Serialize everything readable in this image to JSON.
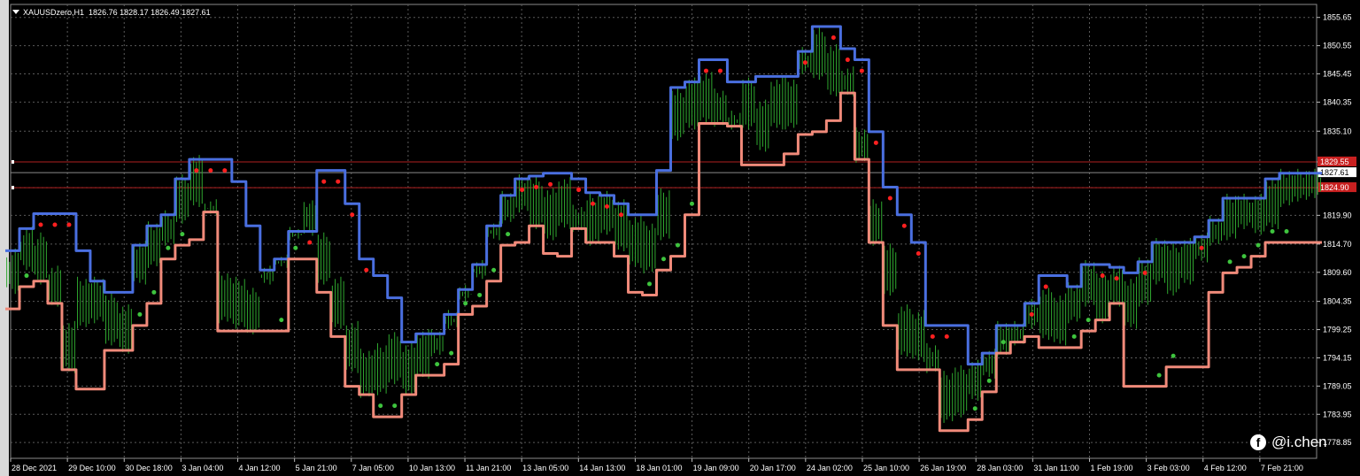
{
  "header": {
    "symbol": "XAUUSDzero,H1",
    "ohlc": "1826.76 1828.17 1826.49 1827.61"
  },
  "watermark": {
    "text": "@i.chen",
    "icon": "facebook-icon"
  },
  "colors": {
    "background": "#000000",
    "grid": "#5a5a5a",
    "upper_band": "#4a6fe0",
    "lower_band": "#f08a7a",
    "candles": "#2fa82f",
    "sell_dots": "#ff2020",
    "buy_dots": "#3ec43e",
    "level_line": "#b02020"
  },
  "chart_data": {
    "type": "line",
    "title": "",
    "xlabel": "",
    "ylabel": "",
    "ylim": [
      1776.0,
      1858.0
    ],
    "y_ticks": [
      "1855.65",
      "1850.55",
      "1845.45",
      "1840.35",
      "1835.10",
      "1829.55",
      "1824.90",
      "1819.90",
      "1814.70",
      "1809.60",
      "1804.35",
      "1799.25",
      "1794.15",
      "1789.05",
      "1783.95",
      "1778.85"
    ],
    "x_ticks": [
      "28 Dec 2021",
      "29 Dec 10:00",
      "30 Dec 18:00",
      "3 Jan 04:00",
      "4 Jan 12:00",
      "5 Jan 21:00",
      "7 Jan 05:00",
      "10 Jan 13:00",
      "11 Jan 21:00",
      "13 Jan 05:00",
      "14 Jan 13:00",
      "18 Jan 01:00",
      "19 Jan 09:00",
      "20 Jan 17:00",
      "24 Jan 02:00",
      "25 Jan 10:00",
      "26 Jan 19:00",
      "28 Jan 03:00",
      "31 Jan 11:00",
      "1 Feb 19:00",
      "3 Feb 03:00",
      "4 Feb 12:00",
      "7 Feb 21:00"
    ],
    "current_price": "1827.61",
    "levels": [
      {
        "label": "1829.55",
        "value": 1829.55
      },
      {
        "label": "1824.90",
        "value": 1824.9
      }
    ],
    "series": [
      {
        "key": "upper",
        "x": [
          0,
          1,
          2,
          3,
          4,
          5,
          6,
          7,
          8,
          9,
          10,
          11,
          12,
          13,
          14,
          15,
          16,
          17,
          18,
          19,
          20,
          21,
          22,
          23,
          24,
          25,
          26,
          27,
          28,
          29,
          30,
          31,
          32,
          33,
          34,
          35,
          36,
          37,
          38,
          39,
          40,
          41,
          42,
          43,
          44,
          45,
          46,
          47,
          48,
          49,
          50,
          51,
          52,
          53,
          54,
          55,
          56,
          57,
          58,
          59,
          60,
          61,
          62,
          63,
          64,
          65,
          66,
          67,
          68,
          69,
          70,
          71,
          72,
          73,
          74,
          75,
          76,
          77,
          78,
          79,
          80,
          81,
          82,
          83,
          84,
          85,
          86,
          87,
          88,
          89,
          90,
          91,
          92
        ],
        "y": [
          1813.5,
          1817.5,
          1820.2,
          1820.2,
          1820.2,
          1813.5,
          1808.0,
          1806.0,
          1806.0,
          1814.5,
          1818.0,
          1820.0,
          1826.5,
          1830.0,
          1830.0,
          1830.0,
          1826.0,
          1818.0,
          1810.0,
          1812.0,
          1817.0,
          1817.0,
          1828.0,
          1828.0,
          1822.0,
          1812.0,
          1809.0,
          1805.0,
          1797.0,
          1798.5,
          1798.5,
          1802.0,
          1806.5,
          1811.0,
          1818.0,
          1823.5,
          1826.5,
          1827.0,
          1827.5,
          1827.5,
          1826.5,
          1824.0,
          1823.5,
          1822.0,
          1820.0,
          1820.0,
          1828.0,
          1843.0,
          1844.0,
          1848.0,
          1848.0,
          1844.0,
          1844.0,
          1845.0,
          1845.0,
          1845.0,
          1849.5,
          1854.0,
          1854.0,
          1850.0,
          1848.0,
          1835.0,
          1825.0,
          1820.0,
          1815.0,
          1800.0,
          1800.0,
          1800.0,
          1793.0,
          1795.0,
          1800.0,
          1800.0,
          1804.0,
          1809.0,
          1809.0,
          1807.0,
          1811.0,
          1811.0,
          1810.5,
          1809.5,
          1811.5,
          1815.0,
          1815.0,
          1815.0,
          1816.0,
          1819.0,
          1823.0,
          1823.0,
          1823.0,
          1826.5,
          1827.5,
          1827.5,
          1827.5
        ]
      },
      {
        "key": "lower",
        "x": [
          0,
          1,
          2,
          3,
          4,
          5,
          6,
          7,
          8,
          9,
          10,
          11,
          12,
          13,
          14,
          15,
          16,
          17,
          18,
          19,
          20,
          21,
          22,
          23,
          24,
          25,
          26,
          27,
          28,
          29,
          30,
          31,
          32,
          33,
          34,
          35,
          36,
          37,
          38,
          39,
          40,
          41,
          42,
          43,
          44,
          45,
          46,
          47,
          48,
          49,
          50,
          51,
          52,
          53,
          54,
          55,
          56,
          57,
          58,
          59,
          60,
          61,
          62,
          63,
          64,
          65,
          66,
          67,
          68,
          69,
          70,
          71,
          72,
          73,
          74,
          75,
          76,
          77,
          78,
          79,
          80,
          81,
          82,
          83,
          84,
          85,
          86,
          87,
          88,
          89,
          90,
          91,
          92
        ],
        "y": [
          1803.0,
          1807.0,
          1808.0,
          1804.0,
          1792.0,
          1788.5,
          1788.5,
          1795.5,
          1795.5,
          1800.0,
          1804.0,
          1812.0,
          1814.5,
          1815.5,
          1820.5,
          1799.0,
          1799.0,
          1799.0,
          1799.0,
          1799.0,
          1812.0,
          1812.0,
          1806.0,
          1798.0,
          1789.0,
          1787.5,
          1783.5,
          1783.5,
          1787.5,
          1791.0,
          1791.0,
          1793.0,
          1802.0,
          1803.5,
          1808.0,
          1814.5,
          1815.0,
          1818.0,
          1813.0,
          1812.5,
          1817.5,
          1815.0,
          1815.0,
          1812.5,
          1806.0,
          1805.5,
          1810.0,
          1812.5,
          1820.0,
          1836.5,
          1836.5,
          1836.0,
          1829.0,
          1829.0,
          1829.0,
          1831.0,
          1834.5,
          1835.0,
          1837.0,
          1842.0,
          1830.0,
          1815.0,
          1800.0,
          1792.0,
          1792.0,
          1792.0,
          1781.0,
          1781.0,
          1783.0,
          1788.0,
          1795.0,
          1797.0,
          1798.0,
          1796.0,
          1796.0,
          1796.0,
          1799.0,
          1801.0,
          1804.0,
          1789.0,
          1789.0,
          1789.0,
          1792.5,
          1792.5,
          1792.5,
          1806.0,
          1809.5,
          1810.5,
          1812.5,
          1815.0,
          1815.0,
          1815.0,
          1815.0
        ]
      },
      {
        "key": "price",
        "x": [
          0,
          1,
          2,
          3,
          4,
          5,
          6,
          7,
          8,
          9,
          10,
          11,
          12,
          13,
          14,
          15,
          16,
          17,
          18,
          19,
          20,
          21,
          22,
          23,
          24,
          25,
          26,
          27,
          28,
          29,
          30,
          31,
          32,
          33,
          34,
          35,
          36,
          37,
          38,
          39,
          40,
          41,
          42,
          43,
          44,
          45,
          46,
          47,
          48,
          49,
          50,
          51,
          52,
          53,
          54,
          55,
          56,
          57,
          58,
          59,
          60,
          61,
          62,
          63,
          64,
          65,
          66,
          67,
          68,
          69,
          70,
          71,
          72,
          73,
          74,
          75,
          76,
          77,
          78,
          79,
          80,
          81,
          82,
          83,
          84,
          85,
          86,
          87,
          88,
          89,
          90,
          91,
          92
        ],
        "y": [
          1810.0,
          1814.0,
          1812.0,
          1806.0,
          1796.0,
          1804.0,
          1805.0,
          1801.0,
          1799.0,
          1812.0,
          1815.0,
          1819.0,
          1823.0,
          1826.0,
          1818.0,
          1805.0,
          1804.0,
          1802.0,
          1812.0,
          1815.0,
          1820.0,
          1826.0,
          1812.0,
          1804.0,
          1796.0,
          1791.0,
          1792.0,
          1794.0,
          1792.0,
          1795.0,
          1799.0,
          1804.0,
          1809.0,
          1813.0,
          1820.0,
          1823.0,
          1825.0,
          1822.0,
          1820.0,
          1822.0,
          1817.0,
          1819.0,
          1821.0,
          1818.0,
          1815.0,
          1814.0,
          1820.0,
          1838.0,
          1840.0,
          1841.0,
          1838.0,
          1834.0,
          1840.0,
          1836.0,
          1840.0,
          1840.0,
          1850.0,
          1849.0,
          1846.0,
          1842.0,
          1831.0,
          1818.0,
          1810.0,
          1799.0,
          1798.0,
          1792.0,
          1787.0,
          1788.0,
          1791.0,
          1795.0,
          1798.0,
          1799.0,
          1804.0,
          1802.0,
          1801.0,
          1805.0,
          1808.0,
          1805.0,
          1806.0,
          1804.0,
          1808.0,
          1812.0,
          1810.0,
          1812.0,
          1816.0,
          1819.0,
          1820.0,
          1822.0,
          1821.0,
          1822.0,
          1826.0,
          1827.0,
          1827.61
        ]
      }
    ],
    "markers": {
      "sell_x": [
        2,
        3,
        4,
        13,
        14,
        15,
        21,
        22,
        23,
        24,
        25,
        36,
        37,
        38,
        40,
        41,
        42,
        43,
        49,
        50,
        56,
        58,
        59,
        60,
        61,
        62,
        63,
        64,
        65,
        66,
        72,
        73,
        77,
        78,
        80,
        84
      ],
      "buy_x": [
        1,
        9,
        10,
        11,
        12,
        19,
        20,
        26,
        27,
        30,
        31,
        32,
        33,
        34,
        35,
        45,
        46,
        47,
        48,
        68,
        69,
        70,
        75,
        76,
        81,
        82,
        86,
        87,
        88,
        89,
        90
      ]
    },
    "grid": true,
    "legend": "none"
  }
}
